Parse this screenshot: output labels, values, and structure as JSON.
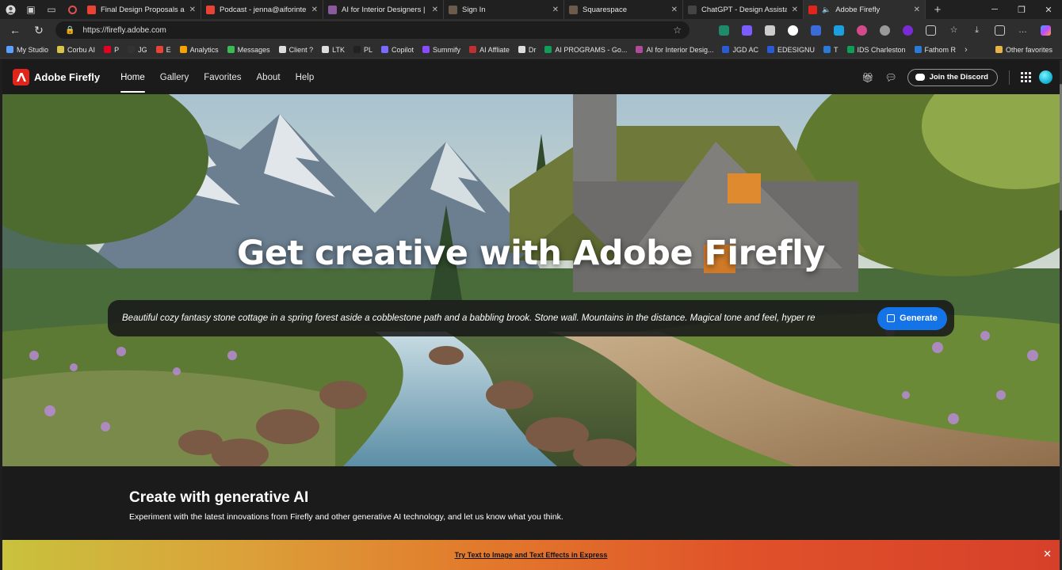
{
  "browser": {
    "tabs": [
      {
        "title": "Final Design Proposals are Re",
        "favicon_color": "#ea4335",
        "active": false
      },
      {
        "title": "Podcast - jenna@aiforinterior",
        "favicon_color": "#ea4335",
        "active": false
      },
      {
        "title": "AI for Interior Designers | Trel",
        "favicon_color": "#8a5a9a",
        "active": false
      },
      {
        "title": "Sign In",
        "favicon_color": "#6b5b4b",
        "active": false
      },
      {
        "title": "Squarespace",
        "favicon_color": "#6b5b4b",
        "active": false
      },
      {
        "title": "ChatGPT - Design Assistant",
        "favicon_color": "#444444",
        "active": false
      },
      {
        "title": "Adobe Firefly",
        "favicon_color": "#e1251b",
        "active": true
      }
    ],
    "new_tab_label": "+",
    "url": "https://firefly.adobe.com",
    "bookmarks": [
      {
        "label": "My Studio",
        "color": "#5aa0ff"
      },
      {
        "label": "Corbu AI",
        "color": "#d8c44a"
      },
      {
        "label": "P",
        "color": "#e60023"
      },
      {
        "label": "JG",
        "color": "#333333"
      },
      {
        "label": "E",
        "color": "#ea4335"
      },
      {
        "label": "Analytics",
        "color": "#f4a300"
      },
      {
        "label": "Messages",
        "color": "#3cba54"
      },
      {
        "label": "Client ?",
        "color": "#dddddd"
      },
      {
        "label": "LTK",
        "color": "#dddddd"
      },
      {
        "label": "PL",
        "color": "#222222"
      },
      {
        "label": "Copilot",
        "color": "#7a6bff"
      },
      {
        "label": "Summify",
        "color": "#8a4bff"
      },
      {
        "label": "AI Affliate",
        "color": "#c03030"
      },
      {
        "label": "Dr",
        "color": "#dddddd"
      },
      {
        "label": "AI PROGRAMS - Go...",
        "color": "#0f9d58"
      },
      {
        "label": "AI for Interior Desig...",
        "color": "#b04a9a"
      },
      {
        "label": "JGD AC",
        "color": "#2a5bd7"
      },
      {
        "label": "EDESIGNU",
        "color": "#2a5bd7"
      },
      {
        "label": "T",
        "color": "#2a7bd7"
      },
      {
        "label": "IDS Charleston",
        "color": "#0f9d58"
      },
      {
        "label": "Fathom R",
        "color": "#2a7bd7"
      }
    ],
    "other_favorites": "Other favorites"
  },
  "firefly": {
    "brand": "Adobe Firefly",
    "nav": [
      "Home",
      "Gallery",
      "Favorites",
      "About",
      "Help"
    ],
    "discord_label": "Join the Discord",
    "hero_title": "Get creative with Adobe Firefly",
    "prompt_text": "Beautiful cozy fantasy stone cottage in a spring forest aside a cobblestone path and a babbling brook. Stone wall. Mountains in the distance. Magical tone and feel, hyper re",
    "generate_label": "Generate",
    "section_title": "Create with generative AI",
    "section_subtitle": "Experiment with the latest innovations from Firefly and other generative AI technology, and let us know what you think.",
    "promo_link": "Try Text to Image and Text Effects in Express"
  },
  "colors": {
    "accent_blue": "#1473e6",
    "adobe_red": "#e1251b"
  }
}
